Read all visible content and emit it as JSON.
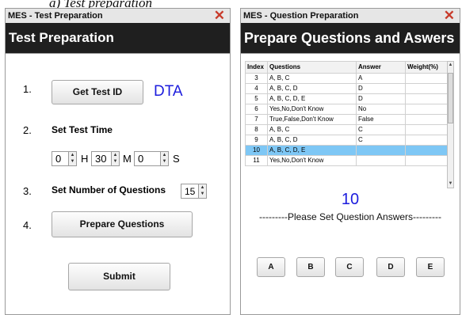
{
  "caption": "a) Test preparation",
  "left": {
    "window_title": "MES - Test Preparation",
    "header": "Test Preparation",
    "steps": [
      {
        "number": "1.",
        "button": "Get Test ID",
        "value": "DTA"
      },
      {
        "number": "2.",
        "label": "Set Test Time"
      },
      {
        "number": "3.",
        "label": "Set Number of Questions",
        "value": "15"
      },
      {
        "number": "4.",
        "button": "Prepare Questions"
      }
    ],
    "time": {
      "hours": "0",
      "hours_unit": "H",
      "minutes": "30",
      "minutes_unit": "M",
      "seconds": "0",
      "seconds_unit": "S"
    },
    "submit": "Submit"
  },
  "right": {
    "window_title": "MES - Question Preparation",
    "header": "Prepare Questions and Aswers",
    "columns": [
      "Index",
      "Questions",
      "Answer",
      "Weight(%)"
    ],
    "rows": [
      {
        "index": "3",
        "question": "A, B, C",
        "answer": "A",
        "weight": ""
      },
      {
        "index": "4",
        "question": "A, B, C, D",
        "answer": "D",
        "weight": ""
      },
      {
        "index": "5",
        "question": "A, B, C, D, E",
        "answer": "D",
        "weight": ""
      },
      {
        "index": "6",
        "question": "Yes,No,Don't Know",
        "answer": "No",
        "weight": ""
      },
      {
        "index": "7",
        "question": "True,False,Don't Know",
        "answer": "False",
        "weight": ""
      },
      {
        "index": "8",
        "question": "A, B, C",
        "answer": "C",
        "weight": ""
      },
      {
        "index": "9",
        "question": "A, B, C, D",
        "answer": "C",
        "weight": ""
      },
      {
        "index": "10",
        "question": "A, B, C, D, E",
        "answer": "",
        "weight": ""
      },
      {
        "index": "11",
        "question": "Yes,No,Don't Know",
        "answer": "",
        "weight": ""
      }
    ],
    "selected_row": 7,
    "current_question": "10",
    "instruction": "---------Please Set Question Answers---------",
    "answer_buttons": [
      "A",
      "B",
      "C",
      "D",
      "E"
    ]
  },
  "colors": {
    "header_bg": "#1f1f1f",
    "accent_blue": "#1c1cdd",
    "selected_row": "#7ec7f5",
    "close_red": "#c83a2a"
  },
  "icons": {
    "close": "close-x-icon",
    "spin": "spin-arrows-icon"
  }
}
